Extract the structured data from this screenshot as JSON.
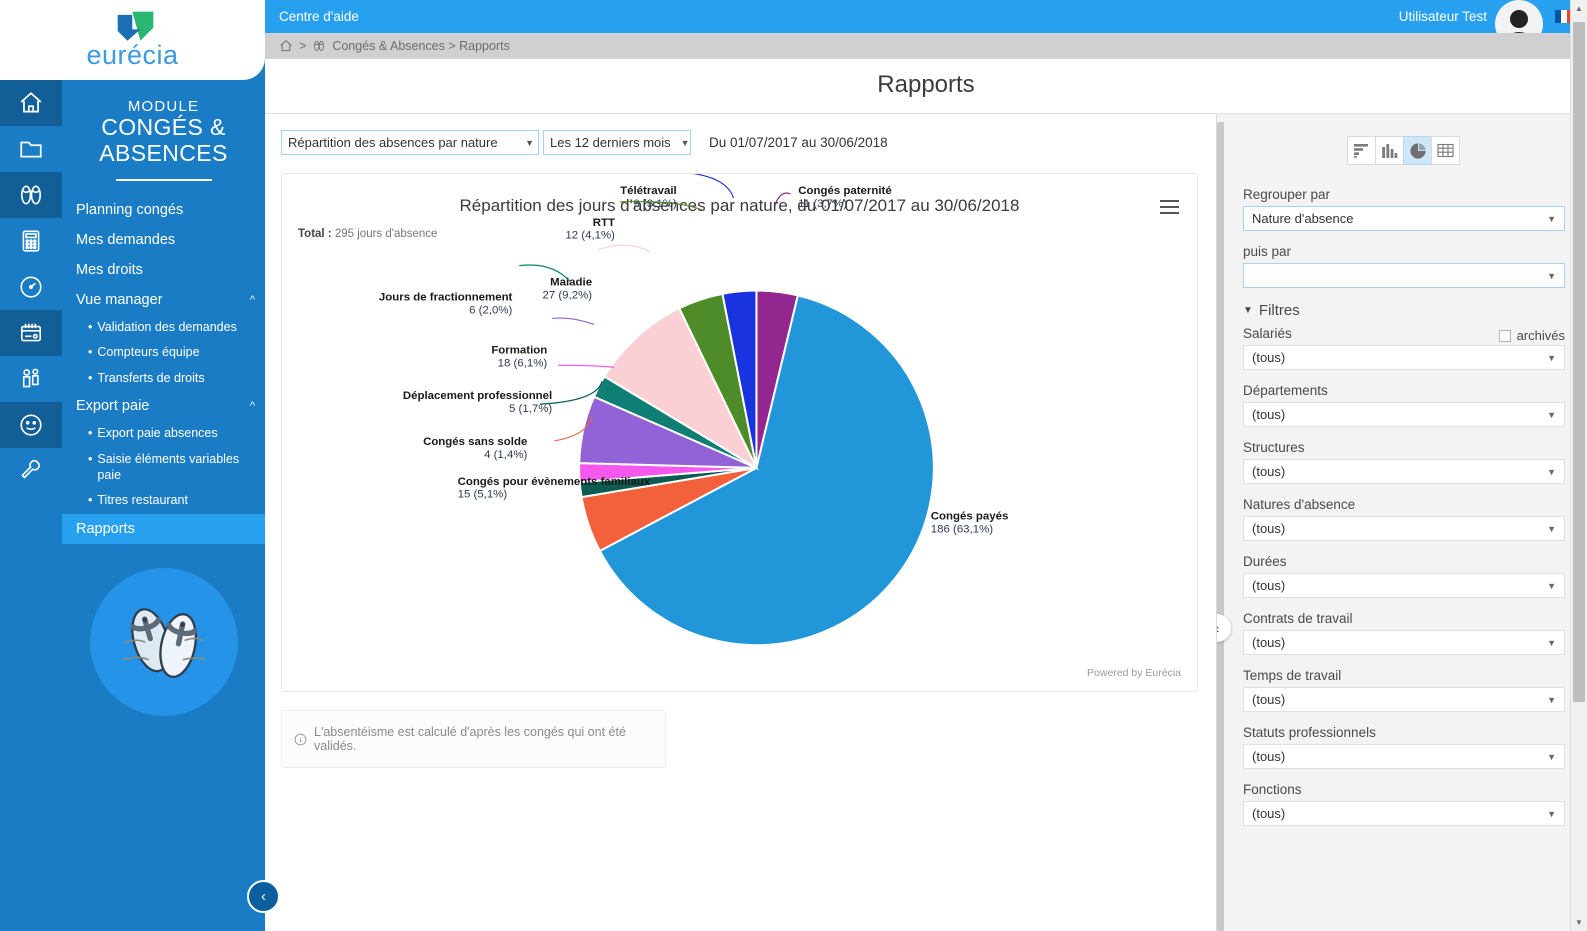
{
  "brand": {
    "name": "eurécia",
    "accent": "#27a0f0",
    "sidebar_bg": "#1a7cc4",
    "rail_bg": "#125e96"
  },
  "topbar": {
    "help_center": "Centre d'aide",
    "user_name": "Utilisateur  Test",
    "avatar_icon": "user-avatar-icon",
    "flag_icon": "french-flag-icon"
  },
  "breadcrumb": {
    "home_icon": "home-icon",
    "module_icon": "flipflop-icon",
    "path": "Congés & Absences > Rapports"
  },
  "page": {
    "title": "Rapports"
  },
  "sidebar": {
    "module_prefix": "MODULE",
    "module_name": "CONGÉS &\nABSENCES",
    "module_line1": "MODULE",
    "module_line2": "CONGÉS &",
    "module_line3": "ABSENCES",
    "rail_icons": [
      {
        "name": "home-icon",
        "active": true
      },
      {
        "name": "folder-icon",
        "active": true
      },
      {
        "name": "flipflop-icon",
        "active": false
      },
      {
        "name": "calculator-icon",
        "active": true
      },
      {
        "name": "speedometer-icon",
        "active": false
      },
      {
        "name": "calendar-icon",
        "active": true
      },
      {
        "name": "people-icon",
        "active": false
      },
      {
        "name": "smiley-icon",
        "active": true
      },
      {
        "name": "wrench-icon",
        "active": false
      }
    ],
    "items": [
      {
        "label": "Planning congés",
        "type": "link"
      },
      {
        "label": "Mes demandes",
        "type": "link"
      },
      {
        "label": "Mes droits",
        "type": "link"
      },
      {
        "label": "Vue manager",
        "type": "group",
        "expanded": true,
        "chevron": "chevron-up-icon"
      },
      {
        "label": "Validation des demandes",
        "type": "sub"
      },
      {
        "label": "Compteurs équipe",
        "type": "sub"
      },
      {
        "label": "Transferts de droits",
        "type": "sub"
      },
      {
        "label": "Export paie",
        "type": "group",
        "expanded": true,
        "chevron": "chevron-up-icon"
      },
      {
        "label": "Export paie absences",
        "type": "sub"
      },
      {
        "label": "Saisie éléments variables paie",
        "type": "sub"
      },
      {
        "label": "Titres restaurant",
        "type": "sub"
      },
      {
        "label": "Rapports",
        "type": "link",
        "active": true
      }
    ],
    "collapse_label": "‹"
  },
  "controls": {
    "report_select": "Répartition des absences par nature",
    "period_select": "Les 12 derniers mois",
    "date_range": "Du 01/07/2017  au 30/06/2018"
  },
  "chart_card": {
    "title": "Répartition des jours d'absences par nature, du 01/07/2017 au 30/06/2018",
    "total_label": "Total :",
    "total_value": "295 jours d'absence",
    "menu_icon": "hamburger-menu-icon",
    "powered_by": "Powered by Eurécia"
  },
  "note": {
    "icon": "info-icon",
    "text": "L'absentéisme est calculé d'après les congés qui ont été validés."
  },
  "right_panel": {
    "view_tabs": [
      {
        "name": "horizontal-bar-chart-icon",
        "selected": false
      },
      {
        "name": "vertical-bar-chart-icon",
        "selected": false
      },
      {
        "name": "pie-chart-icon",
        "selected": true
      },
      {
        "name": "table-icon",
        "selected": false
      }
    ],
    "group_by_label": "Regrouper par",
    "group_by_value": "Nature d'absence",
    "then_by_label": "puis par",
    "then_by_value": "",
    "filters_label": "Filtres",
    "filters_expanded": true,
    "archived_label": "archivés",
    "archived_checked": false,
    "filters": [
      {
        "label": "Salariés",
        "value": "(tous)"
      },
      {
        "label": "Départements",
        "value": "(tous)"
      },
      {
        "label": "Structures",
        "value": "(tous)"
      },
      {
        "label": "Natures d'absence",
        "value": "(tous)"
      },
      {
        "label": "Durées",
        "value": "(tous)"
      },
      {
        "label": "Contrats de travail",
        "value": "(tous)"
      },
      {
        "label": "Temps de travail",
        "value": "(tous)"
      },
      {
        "label": "Statuts professionnels",
        "value": "(tous)"
      },
      {
        "label": "Fonctions",
        "value": "(tous)"
      }
    ],
    "collapse_panel_label": "‹"
  },
  "chart_data": {
    "type": "pie",
    "title": "Répartition des jours d'absences par nature, du 01/07/2017 au 30/06/2018",
    "subtitle": "Total : 295 jours d'absence",
    "total": 295,
    "unit": "jours d'absence",
    "legend_position": "labels-outside",
    "categories": [
      "Congés payés",
      "Congés paternité",
      "Télétravail",
      "RTT",
      "Maladie",
      "Jours de fractionnement",
      "Formation",
      "Déplacement professionnel",
      "Congés sans solde",
      "Congés pour évènements familiaux"
    ],
    "values": [
      186,
      11,
      9,
      12,
      27,
      6,
      18,
      5,
      4,
      15
    ],
    "percents": [
      63.1,
      3.7,
      3.1,
      4.1,
      9.2,
      2.0,
      6.1,
      1.7,
      1.4,
      5.1
    ],
    "labels": [
      "186 (63,1%)",
      "11 (3,7%)",
      "9 (3,1%)",
      "12 (4,1%)",
      "27 (9,2%)",
      "6 (2,0%)",
      "18 (6,1%)",
      "5 (1,7%)",
      "4 (1,4%)",
      "15 (5,1%)"
    ],
    "colors": [
      "#2196d9",
      "#93278f",
      "#1a33e0",
      "#4d8c28",
      "#fbd0d4",
      "#0f7f75",
      "#9163d6",
      "#f558ef",
      "#0d5c52",
      "#f2603c"
    ]
  }
}
